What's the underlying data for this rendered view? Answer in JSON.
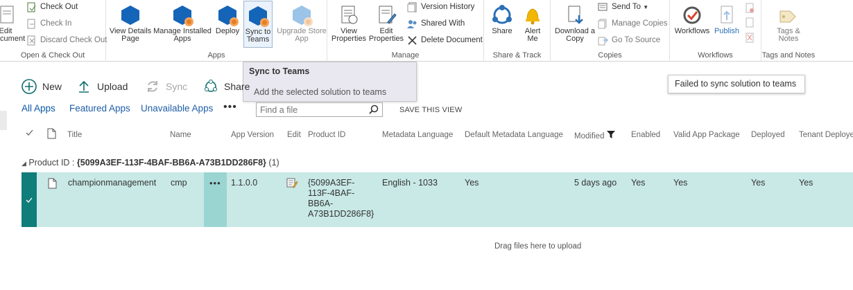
{
  "ribbon": {
    "open_checkout": {
      "label": "Open & Check Out",
      "edit_document": "Edit\nDocument",
      "check_out": "Check Out",
      "check_in": "Check In",
      "discard_check_out": "Discard Check Out"
    },
    "apps": {
      "label": "Apps",
      "view_details": "View Details\nPage",
      "manage_installed": "Manage Installed\nApps",
      "deploy": "Deploy",
      "sync_to_teams": "Sync to\nTeams",
      "upgrade_store_app": "Upgrade Store\nApp"
    },
    "manage": {
      "label": "Manage",
      "view_properties": "View\nProperties",
      "edit_properties": "Edit\nProperties",
      "version_history": "Version History",
      "shared_with": "Shared With",
      "delete_document": "Delete Document"
    },
    "share_track": {
      "label": "Share & Track",
      "share": "Share",
      "alert_me": "Alert\nMe"
    },
    "copies": {
      "label": "Copies",
      "download_copy": "Download a\nCopy",
      "send_to": "Send To",
      "manage_copies": "Manage Copies",
      "go_to_source": "Go To Source"
    },
    "workflows": {
      "label": "Workflows",
      "workflows": "Workflows",
      "publish": "Publish"
    },
    "tags_notes": {
      "label": "Tags and Notes",
      "tags_notes": "Tags &\nNotes"
    }
  },
  "tooltip": {
    "title": "Sync to Teams",
    "description": "Add the selected solution to teams"
  },
  "error_message": "Failed to sync solution to teams",
  "command_bar": {
    "new": "New",
    "upload": "Upload",
    "sync": "Sync",
    "share": "Share"
  },
  "views": {
    "all_apps": "All Apps",
    "featured_apps": "Featured Apps",
    "unavailable_apps": "Unavailable Apps",
    "more": "•••",
    "search_placeholder": "Find a file",
    "save_view": "SAVE THIS VIEW"
  },
  "table": {
    "headers": {
      "title": "Title",
      "name": "Name",
      "app_version": "App Version",
      "edit": "Edit",
      "product_id": "Product ID",
      "metadata_language": "Metadata Language",
      "default_metadata_language": "Default Metadata Language",
      "modified": "Modified",
      "enabled": "Enabled",
      "valid_app_package": "Valid App Package",
      "deployed": "Deployed",
      "tenant_deployed": "Tenant Deployed"
    },
    "group": {
      "label": "Product ID :",
      "value": "{5099A3EF-113F-4BAF-BB6A-A73B1DD286F8}",
      "count": "(1)"
    },
    "rows": [
      {
        "title": "championmanagement",
        "name": "cmp",
        "app_version": "1.1.0.0",
        "product_id_lines": [
          "{5099A3EF-",
          "113F-4BAF-",
          "BB6A-",
          "A73B1DD286F8}"
        ],
        "metadata_language": "English - 1033",
        "default_metadata_language": "Yes",
        "modified": "5 days ago",
        "enabled": "Yes",
        "valid_app_package": "Yes",
        "deployed": "Yes",
        "tenant_deployed": "Yes"
      }
    ]
  },
  "drag_hint": "Drag files here to upload",
  "colors": {
    "accent": "#1464b8",
    "selected_row": "#c8e9e6",
    "selected_marker": "#0f7d7a",
    "link": "#1f5ea8"
  }
}
